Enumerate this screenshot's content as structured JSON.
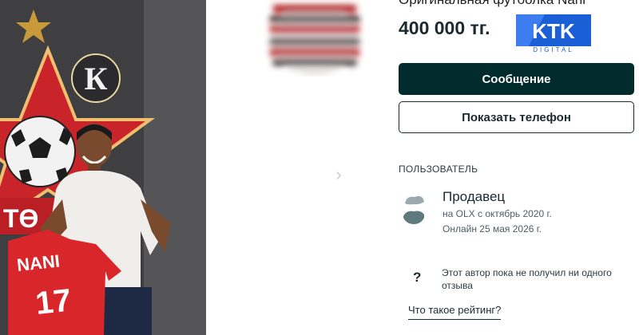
{
  "listing": {
    "title": "Оригинальная футболка Nani",
    "price": "400 000 тг."
  },
  "watermark": {
    "brand": "KTK",
    "sub": "DIGITAL",
    "color": "#1a5fd6"
  },
  "photo": {
    "jersey_name": "NANI",
    "jersey_number": "17",
    "club_letter": "К",
    "club_partial": "ТӨ",
    "accent_red": "#d9262b"
  },
  "actions": {
    "message_label": "Сообщение",
    "phone_label": "Показать телефон"
  },
  "user": {
    "section_label": "ПОЛЬЗОВАТЕЛЬ",
    "name": "Продавец",
    "since": "на OLX с октябрь 2020 г.",
    "online": "Онлайн 25 мая 2026 г."
  },
  "rating": {
    "icon": "?",
    "text": "Этот автор пока не получил ни одного отзыва",
    "link": "Что такое рейтинг?"
  },
  "gallery": {
    "next_icon": "›"
  },
  "colors": {
    "primary": "#012b2d",
    "text": "#1b2a30"
  }
}
